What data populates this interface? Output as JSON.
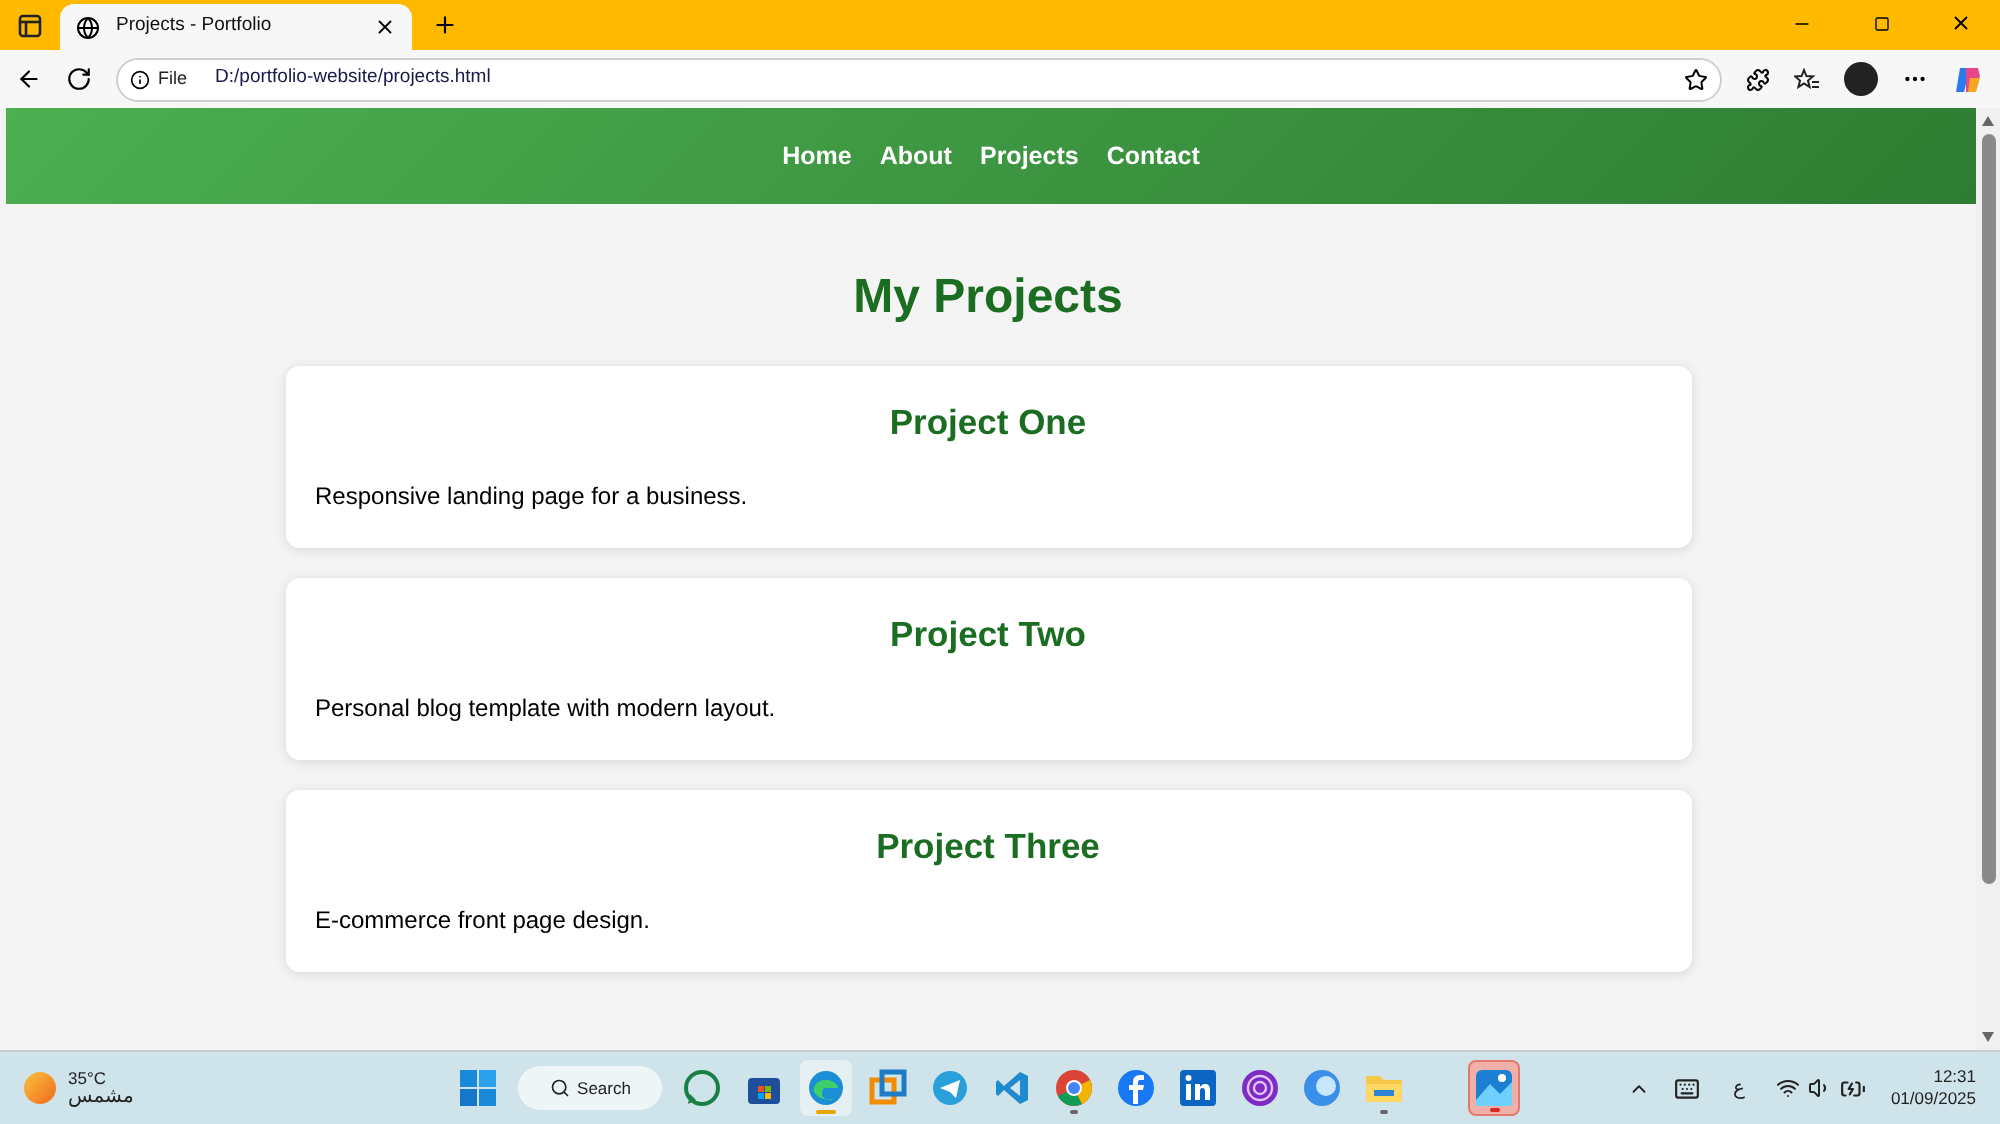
{
  "browser": {
    "tab": {
      "title": "Projects - Portfolio"
    },
    "address": {
      "scheme": "File",
      "url": "D:/portfolio-website/projects.html"
    }
  },
  "nav": {
    "items": [
      {
        "label": "Home"
      },
      {
        "label": "About"
      },
      {
        "label": "Projects"
      },
      {
        "label": "Contact"
      }
    ]
  },
  "page": {
    "heading": "My Projects",
    "projects": [
      {
        "title": "Project One",
        "description": "Responsive landing page for a business."
      },
      {
        "title": "Project Two",
        "description": "Personal blog template with modern layout."
      },
      {
        "title": "Project Three",
        "description": "E-commerce front page design."
      }
    ]
  },
  "taskbar": {
    "weather": {
      "temperature": "35°C",
      "condition": "مشمس"
    },
    "search": "Search",
    "apps": [
      {
        "kind": "whatsapp",
        "running": false,
        "selected": false
      },
      {
        "kind": "store",
        "running": false,
        "selected": false
      },
      {
        "kind": "edge",
        "running": true,
        "selected": true
      },
      {
        "kind": "vmware",
        "running": false,
        "selected": false
      },
      {
        "kind": "telegram",
        "running": false,
        "selected": false
      },
      {
        "kind": "vscode",
        "running": false,
        "selected": false
      },
      {
        "kind": "chrome",
        "running": true,
        "selected": false
      },
      {
        "kind": "facebook",
        "running": false,
        "selected": false
      },
      {
        "kind": "linkedin",
        "running": false,
        "selected": false
      },
      {
        "kind": "tor",
        "running": false,
        "selected": false
      },
      {
        "kind": "app",
        "running": false,
        "selected": false
      },
      {
        "kind": "explorer",
        "running": true,
        "selected": false
      },
      {
        "kind": "photos",
        "running": true,
        "selected": false,
        "flashing": true
      }
    ],
    "language": "ع",
    "time": "12:31",
    "date": "01/09/2025"
  }
}
